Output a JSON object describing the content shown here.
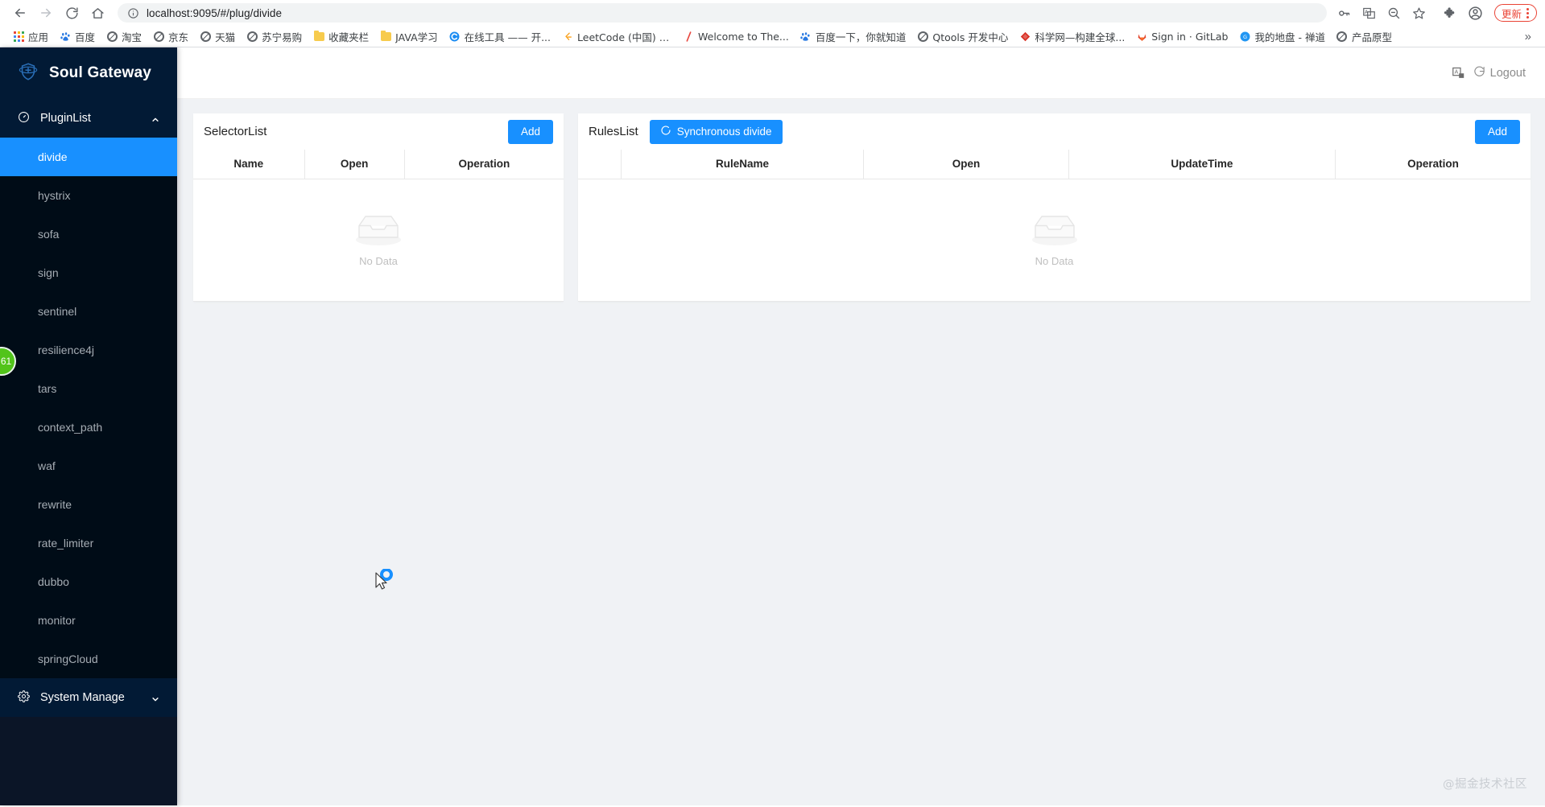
{
  "browser": {
    "url": "localhost:9095/#/plug/divide",
    "nav": {
      "back": "back-arrow",
      "forward": "forward-arrow",
      "reload": "reload",
      "home": "home"
    },
    "omnibox_icons": [
      "info-circle",
      "password-key",
      "translate",
      "zoom-out",
      "bookmark-star"
    ],
    "extensions_icon": "puzzle-piece",
    "profile_icon": "account-circle",
    "update_label": "更新",
    "overflow_label": "»",
    "bookmarks": [
      {
        "label": "应用",
        "icon": "apps-grid"
      },
      {
        "label": "百度",
        "icon": "baidu-paw"
      },
      {
        "label": "淘宝",
        "icon": "globe"
      },
      {
        "label": "京东",
        "icon": "globe"
      },
      {
        "label": "天猫",
        "icon": "globe"
      },
      {
        "label": "苏宁易购",
        "icon": "globe"
      },
      {
        "label": "收藏夹栏",
        "icon": "folder"
      },
      {
        "label": "JAVA学习",
        "icon": "folder"
      },
      {
        "label": "在线工具 —— 开...",
        "icon": "c-circle"
      },
      {
        "label": "LeetCode (中国) -...",
        "icon": "leetcode"
      },
      {
        "label": "Welcome to The...",
        "icon": "slash"
      },
      {
        "label": "百度一下，你就知道",
        "icon": "baidu-paw"
      },
      {
        "label": "Qtools 开发中心",
        "icon": "globe"
      },
      {
        "label": "科学网—构建全球...",
        "icon": "diamond"
      },
      {
        "label": "Sign in · GitLab",
        "icon": "gitlab-fox"
      },
      {
        "label": "我的地盘 - 禅道",
        "icon": "zentao"
      },
      {
        "label": "产品原型",
        "icon": "globe"
      }
    ]
  },
  "sidebar": {
    "brand": "Soul Gateway",
    "brand_icon": "shield-logo",
    "groups": [
      {
        "label": "PluginList",
        "icon": "dashboard-icon",
        "expanded": true,
        "caret": "chevron-up-icon",
        "items": [
          {
            "label": "divide",
            "active": true
          },
          {
            "label": "hystrix",
            "active": false
          },
          {
            "label": "sofa",
            "active": false
          },
          {
            "label": "sign",
            "active": false
          },
          {
            "label": "sentinel",
            "active": false
          },
          {
            "label": "resilience4j",
            "active": false
          },
          {
            "label": "tars",
            "active": false
          },
          {
            "label": "context_path",
            "active": false
          },
          {
            "label": "waf",
            "active": false
          },
          {
            "label": "rewrite",
            "active": false
          },
          {
            "label": "rate_limiter",
            "active": false
          },
          {
            "label": "dubbo",
            "active": false
          },
          {
            "label": "monitor",
            "active": false
          },
          {
            "label": "springCloud",
            "active": false
          }
        ]
      },
      {
        "label": "System Manage",
        "icon": "gear-icon",
        "expanded": false,
        "caret": "chevron-down-icon",
        "items": []
      }
    ],
    "badge": "61"
  },
  "header": {
    "lang_icon": "translate-icon",
    "logout_icon": "logout-icon",
    "logout_label": "Logout"
  },
  "selector_panel": {
    "title": "SelectorList",
    "add_label": "Add",
    "columns": [
      "Name",
      "Open",
      "Operation"
    ],
    "rows": [],
    "empty_text": "No Data",
    "empty_icon": "empty-box-icon"
  },
  "rules_panel": {
    "title": "RulesList",
    "sync_label": "Synchronous divide",
    "sync_icon": "refresh-icon",
    "add_label": "Add",
    "columns": [
      "",
      "RuleName",
      "Open",
      "UpdateTime",
      "Operation"
    ],
    "rows": [],
    "empty_text": "No Data",
    "empty_icon": "empty-box-icon"
  },
  "watermark": "@掘金技术社区",
  "colors": {
    "accent": "#1890ff",
    "sidebar_bg": "#0b1527",
    "sidebar_header_bg": "#021a35",
    "submenu_bg": "#000c17",
    "badge_green": "#52c41a",
    "update_red": "#ea4335",
    "page_bg": "#f0f2f5"
  }
}
